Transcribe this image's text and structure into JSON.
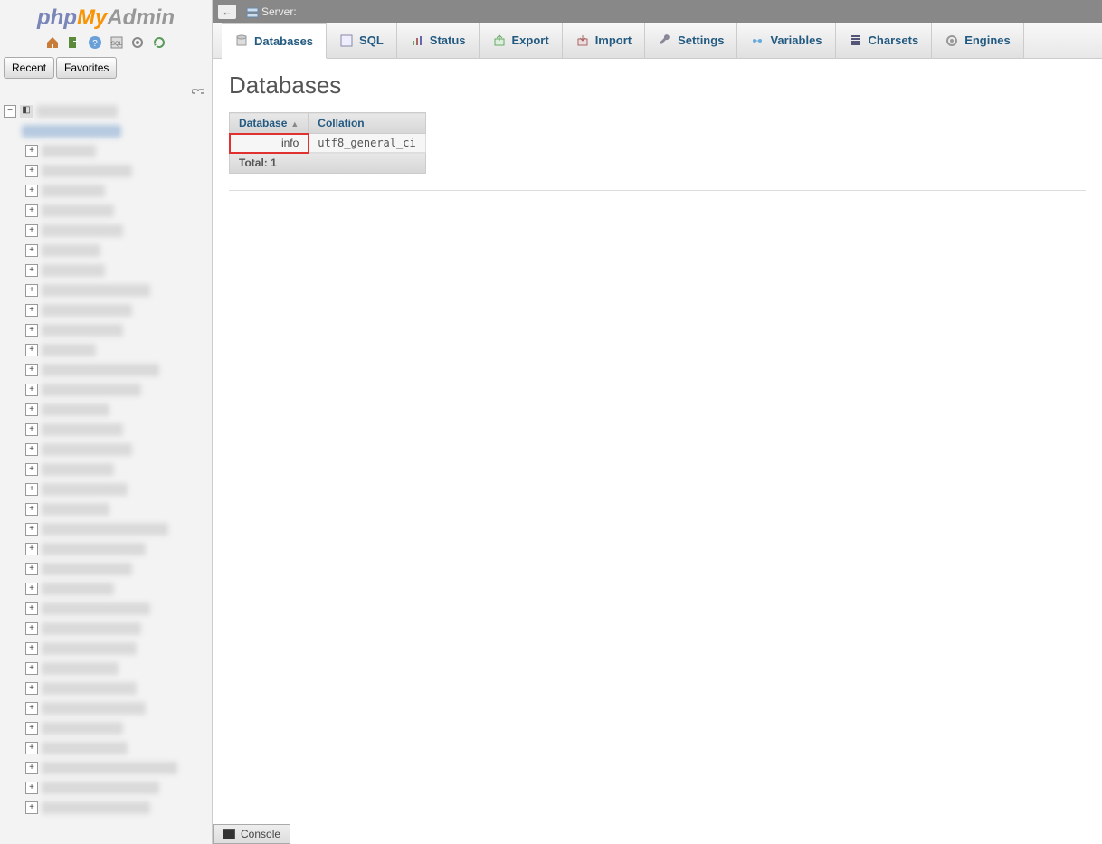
{
  "logo": {
    "part1": "php",
    "part2": "My",
    "part3": "Admin"
  },
  "nav_icon_buttons": [
    "home-icon",
    "exit-icon",
    "help-icon",
    "sql-icon",
    "settings-icon",
    "reload-icon"
  ],
  "recent_fav": {
    "recent": "Recent",
    "favorites": "Favorites"
  },
  "top_bar": {
    "server_label": "Server:"
  },
  "tabs": [
    {
      "label": "Databases",
      "icon": "database-icon",
      "active": true
    },
    {
      "label": "SQL",
      "icon": "sql-icon",
      "active": false
    },
    {
      "label": "Status",
      "icon": "status-icon",
      "active": false
    },
    {
      "label": "Export",
      "icon": "export-icon",
      "active": false
    },
    {
      "label": "Import",
      "icon": "import-icon",
      "active": false
    },
    {
      "label": "Settings",
      "icon": "wrench-icon",
      "active": false
    },
    {
      "label": "Variables",
      "icon": "variables-icon",
      "active": false
    },
    {
      "label": "Charsets",
      "icon": "charsets-icon",
      "active": false
    },
    {
      "label": "Engines",
      "icon": "engines-icon",
      "active": false
    }
  ],
  "page_title": "Databases",
  "table": {
    "head_database": "Database",
    "head_collation": "Collation",
    "rows": [
      {
        "name": "info",
        "collation": "utf8_general_ci"
      }
    ],
    "footer": "Total: 1"
  },
  "console_label": "Console",
  "tree_item_count": 35
}
